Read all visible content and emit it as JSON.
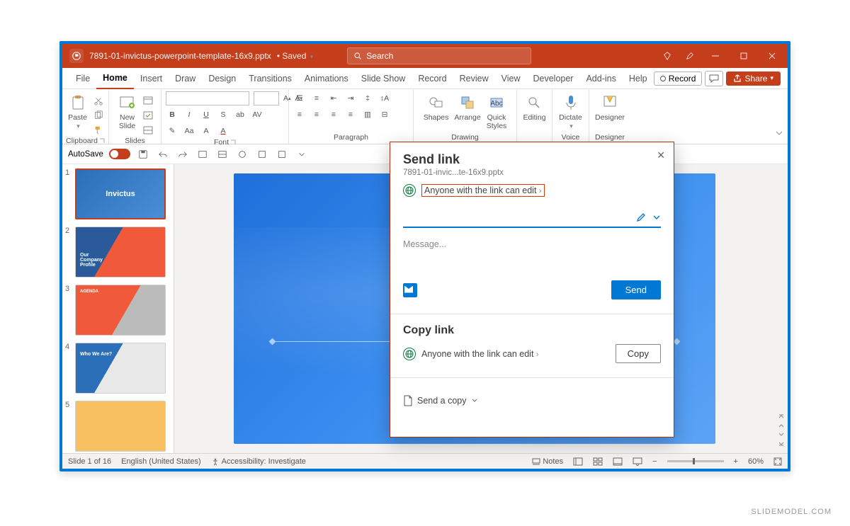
{
  "titlebar": {
    "filename": "7891-01-invictus-powerpoint-template-16x9.pptx",
    "status": "Saved",
    "search_placeholder": "Search"
  },
  "menu": {
    "tabs": [
      "File",
      "Home",
      "Insert",
      "Draw",
      "Design",
      "Transitions",
      "Animations",
      "Slide Show",
      "Record",
      "Review",
      "View",
      "Developer",
      "Add-ins",
      "Help"
    ],
    "active": "Home",
    "record": "Record",
    "share": "Share"
  },
  "ribbon": {
    "clipboard": {
      "paste": "Paste",
      "label": "Clipboard"
    },
    "slides": {
      "new": "New\nSlide",
      "label": "Slides"
    },
    "font": {
      "label": "Font"
    },
    "paragraph": {
      "label": "Paragraph"
    },
    "drawing": {
      "shapes": "Shapes",
      "arrange": "Arrange",
      "quick": "Quick\nStyles",
      "label": "Drawing"
    },
    "editing": {
      "label": "Editing"
    },
    "voice": {
      "dictate": "Dictate",
      "label": "Voice"
    },
    "designer": {
      "designer": "Designer",
      "label": "Designer"
    }
  },
  "qat": {
    "autosave": "AutoSave"
  },
  "thumbs": [
    {
      "num": "1",
      "title": "Invictus"
    },
    {
      "num": "2",
      "title": "Our\nCompany\nProfile"
    },
    {
      "num": "3",
      "title": "AGENDA"
    },
    {
      "num": "4",
      "title": "Who We Are?"
    },
    {
      "num": "5",
      "title": ""
    }
  ],
  "statusbar": {
    "slide": "Slide 1 of 16",
    "lang": "English (United States)",
    "acc": "Accessibility: Investigate",
    "notes": "Notes",
    "zoom": "60%"
  },
  "share": {
    "title": "Send link",
    "filename": "7891-01-invic...te-16x9.pptx",
    "perm": "Anyone with the link can edit",
    "message_placeholder": "Message...",
    "send": "Send",
    "copy_title": "Copy link",
    "copy_perm": "Anyone with the link can edit",
    "copy": "Copy",
    "sendcopy": "Send a copy"
  },
  "watermark": "SLIDEMODEL.COM"
}
